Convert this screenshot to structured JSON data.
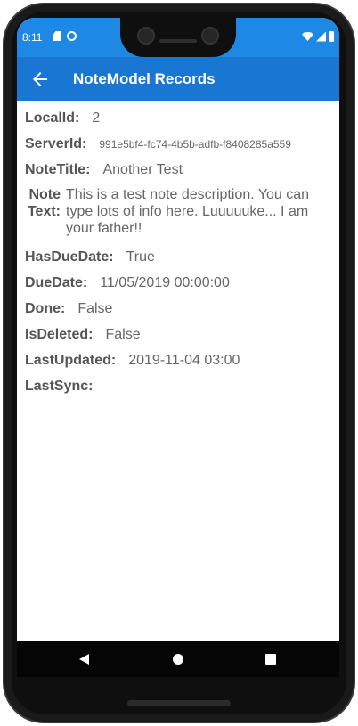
{
  "status": {
    "time": "8:11"
  },
  "appbar": {
    "title": "NoteModel Records"
  },
  "fields": {
    "localid": {
      "label": "LocalId:",
      "value": "2"
    },
    "serverid": {
      "label": "ServerId:",
      "value": "991e5bf4-fc74-4b5b-adfb-f8408285a559"
    },
    "notetitle": {
      "label": "NoteTitle:",
      "value": "Another Test"
    },
    "notetext": {
      "label": "Note Text:",
      "value": "This is a test note description.  You can type lots of info here.  Luuuuuke... I am your father!!"
    },
    "hasduedate": {
      "label": "HasDueDate:",
      "value": "True"
    },
    "duedate": {
      "label": "DueDate:",
      "value": "11/05/2019 00:00:00"
    },
    "done": {
      "label": "Done:",
      "value": "False"
    },
    "isdeleted": {
      "label": "IsDeleted:",
      "value": "False"
    },
    "lastupdated": {
      "label": "LastUpdated:",
      "value": "2019-11-04 03:00"
    },
    "lastsync": {
      "label": "LastSync:",
      "value": ""
    }
  },
  "colors": {
    "statusbar": "#1e88e5",
    "appbar": "#1976d2",
    "label": "#555555",
    "value": "#666666"
  },
  "icons": {
    "back": "arrow-left-icon",
    "nav_back": "triangle-back-icon",
    "nav_home": "circle-home-icon",
    "nav_recents": "square-recents-icon"
  }
}
